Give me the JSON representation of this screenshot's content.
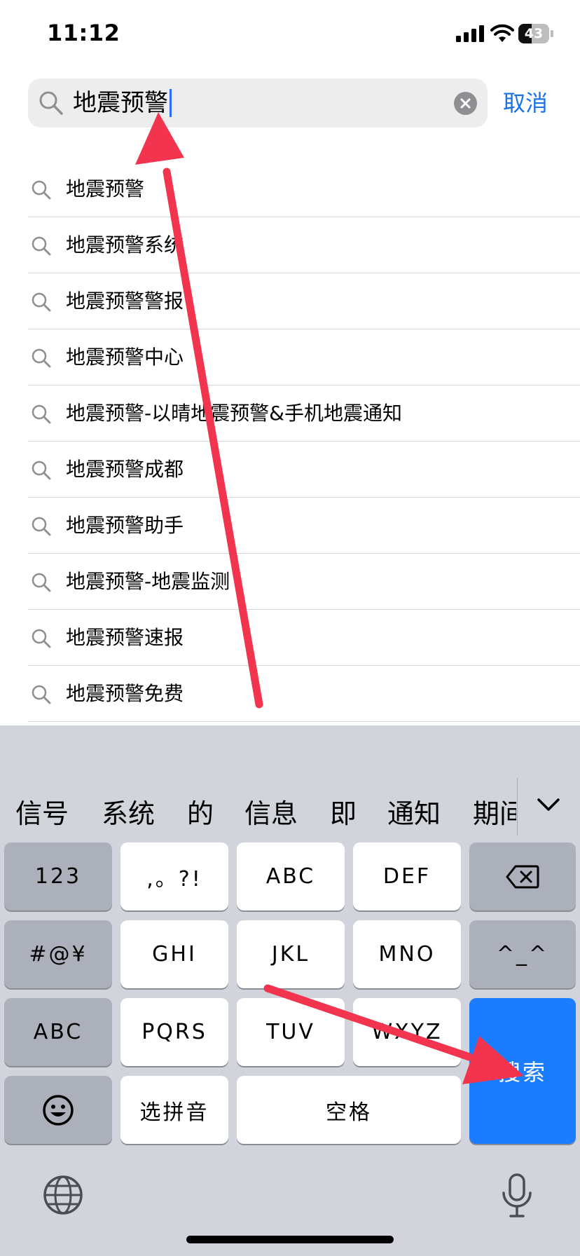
{
  "status_bar": {
    "time": "11:12",
    "battery": "43",
    "battery_level": 0.43
  },
  "search": {
    "query": "地震预警",
    "cancel_label": "取消"
  },
  "suggestions": [
    "地震预警",
    "地震预警系统",
    "地震预警警报",
    "地震预警中心",
    "地震预警-以晴地震预警&手机地震通知",
    "地震预警成都",
    "地震预警助手",
    "地震预警-地震监测",
    "地震预警速报",
    "地震预警免费"
  ],
  "keyboard": {
    "candidates": [
      "信号",
      "系统",
      "的",
      "信息",
      "即",
      "通知",
      "期间"
    ],
    "keys": {
      "num": "123",
      "punct": ",。?!",
      "abc": "ABC",
      "def": "DEF",
      "symbols": "#@¥",
      "ghi": "GHI",
      "jkl": "JKL",
      "mno": "MNO",
      "emoticon": "^_^",
      "abc_switch": "ABC",
      "pqrs": "PQRS",
      "tuv": "TUV",
      "wxyz": "WXYZ",
      "select_pinyin": "选拼音",
      "space": "空格",
      "search": "搜索"
    }
  },
  "colors": {
    "accent": "#1a73e8",
    "search_key": "#1a7cff",
    "annotation_arrow": "#f2344f",
    "keyboard_bg": "#d1d4db"
  },
  "icons": [
    "search-icon",
    "clear-icon",
    "chevron-down-icon",
    "backspace-icon",
    "emoji-icon",
    "globe-icon",
    "microphone-icon"
  ]
}
